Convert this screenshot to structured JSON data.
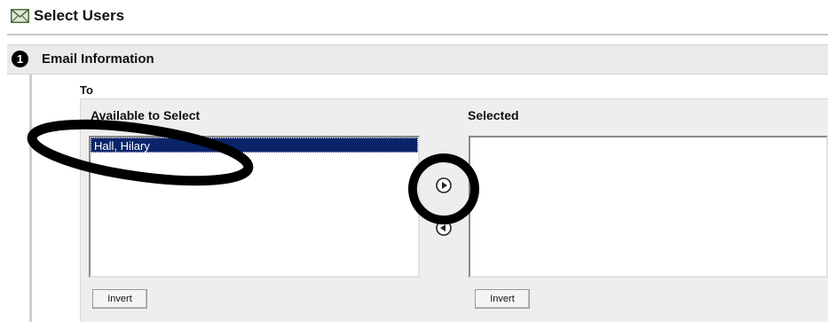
{
  "page": {
    "title": "Select Users",
    "title_icon": "envelope-icon"
  },
  "section": {
    "step_number": "1",
    "title": "Email Information"
  },
  "recipients": {
    "label": "To",
    "available": {
      "header": "Available to Select",
      "options": [
        {
          "label": "Hall, Hilary",
          "selected": true
        }
      ]
    },
    "selected": {
      "header": "Selected",
      "options": []
    },
    "move_right_icon": "arrow-right-circle-icon",
    "move_left_icon": "arrow-left-circle-icon",
    "invert_left_label": "Invert",
    "invert_right_label": "Invert"
  },
  "annotations": {
    "color": "#000000",
    "marks": [
      "ellipse around first available user",
      "circle around move-right button"
    ]
  },
  "colors": {
    "selection_bg": "#0a246a",
    "selection_text": "#ffffff",
    "panel_bg": "#eeeeee",
    "section_bar_bg": "#ebebeb"
  }
}
